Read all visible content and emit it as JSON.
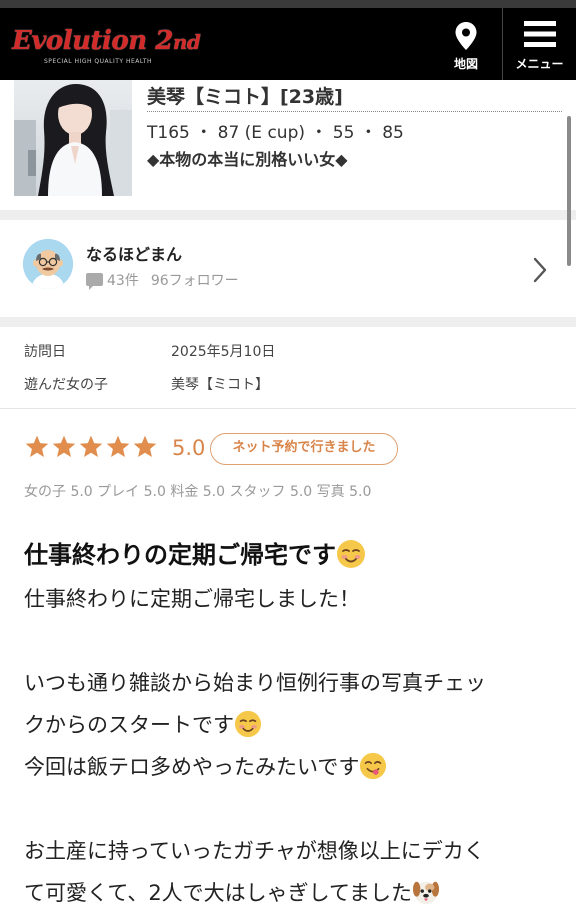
{
  "header": {
    "logo": {
      "main": "Evolution 2",
      "ordinal": "nd",
      "tagline": "SPECIAL HIGH QUALITY HEALTH"
    },
    "map_label": "地図",
    "menu_label": "メニュー"
  },
  "profile": {
    "name": "美琴【ミコト】[23歳]",
    "stats": "T165 ・ 87 (E cup) ・ 55 ・ 85",
    "catchphrase": "◆本物の本当に別格いい女◆"
  },
  "reviewer": {
    "name": "なるほどまん",
    "review_count": "43件",
    "followers": "96フォロワー"
  },
  "visit_info": [
    {
      "label": "訪問日",
      "value": "2025年5月10日"
    },
    {
      "label": "遊んだ女の子",
      "value": "美琴【ミコト】"
    }
  ],
  "rating": {
    "stars": 5,
    "score": "5.0",
    "badge": "ネット予約で行きました",
    "subscores": "女の子 5.0 プレイ 5.0 料金 5.0 スタッフ 5.0 写真 5.0"
  },
  "review": {
    "title": "仕事終わりの定期ご帰宅です",
    "lines": [
      "仕事終わりに定期ご帰宅しました！",
      "",
      "いつも通り雑談から始まり恒例行事の写真チェッ",
      "クからのスタートです",
      "今回は飯テロ多めやったみたいです",
      "",
      "お土産に持っていったガチャが想像以上にデカく",
      "て可愛くて、2人で大はしゃぎしてました"
    ]
  },
  "colors": {
    "accent": "#d9854a",
    "star": "#e08d4d",
    "header_bg": "#000000",
    "logo_red": "#d32a2a",
    "separator": "#eeeeee"
  },
  "icons": {
    "map": "map-pin-icon",
    "menu": "hamburger-icon",
    "chevron": "chevron-right-icon",
    "comment": "comment-bubble-icon"
  }
}
